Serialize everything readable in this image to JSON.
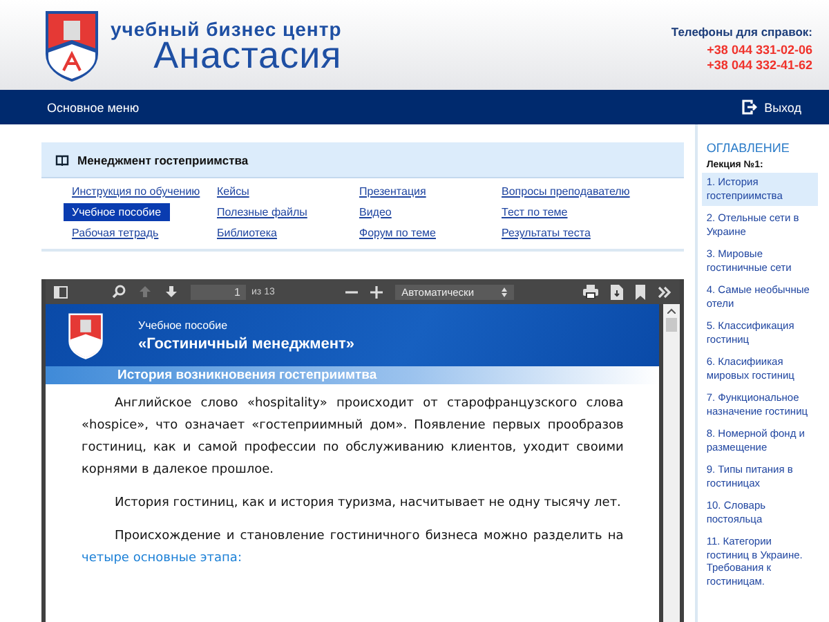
{
  "header": {
    "tagline": "учебный бизнес центр",
    "brand": "Анастасия",
    "phones_label": "Телефоны для справок:",
    "phones": [
      "+38 044 331-02-06",
      "+38 044 332-41-62"
    ]
  },
  "navbar": {
    "menu": "Основное меню",
    "logout": "Выход"
  },
  "course": {
    "title": "Менеджмент гостеприимства",
    "links": [
      {
        "label": "Инструкция по обучению",
        "selected": false
      },
      {
        "label": "Кейсы",
        "selected": false
      },
      {
        "label": "Презентация",
        "selected": false
      },
      {
        "label": "Вопросы преподавателю",
        "selected": false
      },
      {
        "label": "Учебное пособие",
        "selected": true
      },
      {
        "label": "Полезные файлы",
        "selected": false
      },
      {
        "label": "Видео",
        "selected": false
      },
      {
        "label": "Тест по теме",
        "selected": false
      },
      {
        "label": "Рабочая тетрадь",
        "selected": false
      },
      {
        "label": "Библиотека",
        "selected": false
      },
      {
        "label": "Форум по теме",
        "selected": false
      },
      {
        "label": "Результаты теста",
        "selected": false
      }
    ]
  },
  "viewer": {
    "page": "1",
    "page_count": "из 13",
    "zoom": "Автоматически",
    "document": {
      "subtitle": "Учебное пособие",
      "title": "«Гостиничный менеджмент»",
      "section": "История возникновения гостеприимтва",
      "paragraphs": [
        {
          "text": "Английское слово «hospitality» происходит от старофранцузского слова «hospice», что означает «гостеприимный дом». Появление первых прообразов гостиниц, как и самой профессии по обслуживанию клиентов, уходит своими корнями в далекое прошлое."
        },
        {
          "text": "История гостиниц, как и история туризма, насчитывает не одну тысячу лет."
        },
        {
          "text": "Происхождение и становление гостиничного бизнеса можно разделить на",
          "link": "четыре основные этапа:"
        }
      ]
    }
  },
  "toc": {
    "title": "ОГЛАВЛЕНИЕ",
    "lecture": "Лекция №1:",
    "items": [
      {
        "label": "1. История гостеприимства",
        "selected": true
      },
      {
        "label": "2. Отельные сети в Украине",
        "selected": false
      },
      {
        "label": "3. Мировые гостиничные сети",
        "selected": false
      },
      {
        "label": "4. Самые необычные отели",
        "selected": false
      },
      {
        "label": "5. Классификация гостиниц",
        "selected": false
      },
      {
        "label": "6. Класифиикая мировых гостиниц",
        "selected": false
      },
      {
        "label": "7. Функциональное назначение гостиниц",
        "selected": false
      },
      {
        "label": "8. Номерной фонд и размещение",
        "selected": false
      },
      {
        "label": "9. Типы питания в гостиницах",
        "selected": false
      },
      {
        "label": "10. Словарь постояльца",
        "selected": false
      },
      {
        "label": "11. Категории гостиниц в Украине. Требования к гостиницам.",
        "selected": false
      }
    ]
  }
}
